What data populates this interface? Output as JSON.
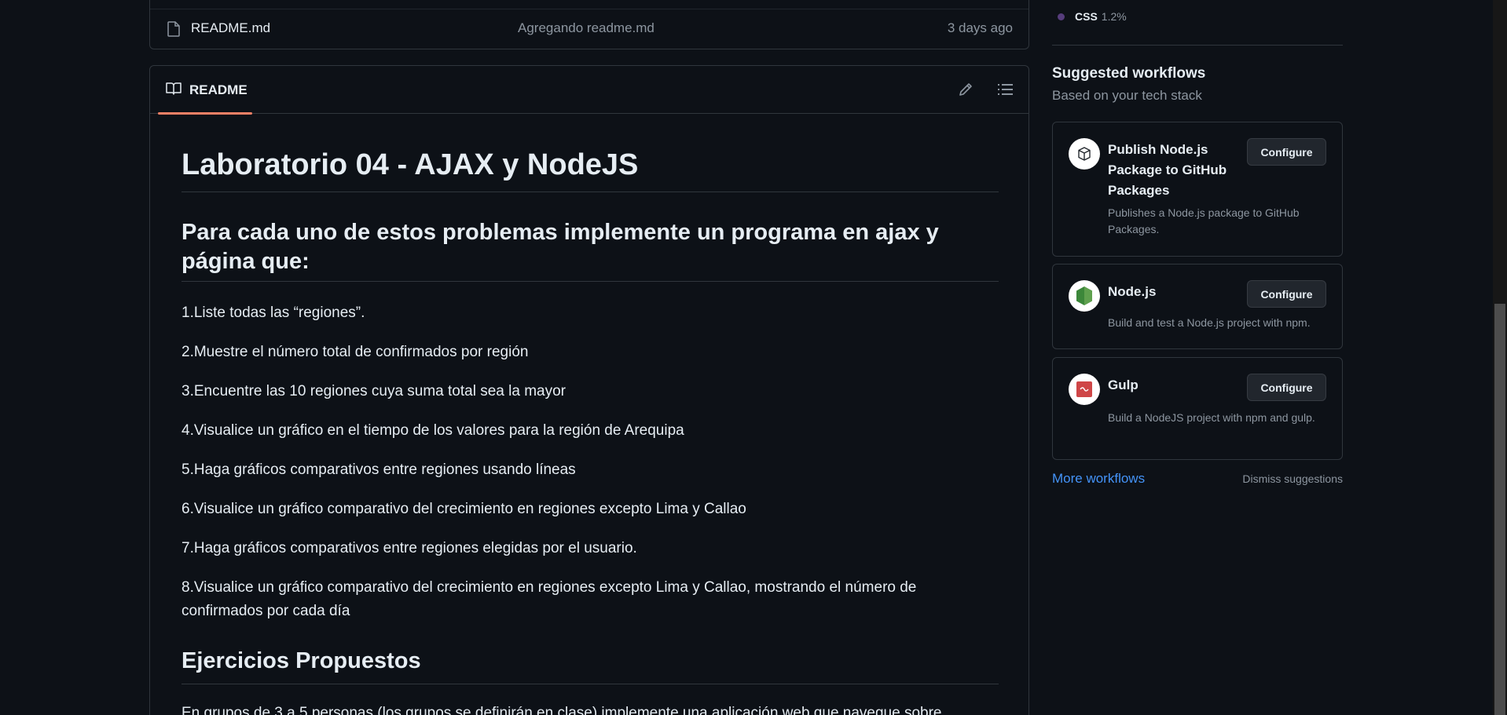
{
  "file_row": {
    "name": "README.md",
    "commit_message": "Agregando readme.md",
    "date": "3 days ago"
  },
  "readme": {
    "tab_label": "README",
    "title": "Laboratorio 04 - AJAX y NodeJS",
    "heading": "Para cada uno de estos problemas implemente un programa en ajax y página que:",
    "items": [
      "1.Liste todas las “regiones”.",
      "2.Muestre el número total de confirmados por región",
      "3.Encuentre las 10 regiones cuya suma total sea la mayor",
      "4.Visualice un gráfico en el tiempo de los valores para la región de Arequipa",
      "5.Haga gráficos comparativos entre regiones usando líneas",
      "6.Visualice un gráfico comparativo del crecimiento en regiones excepto Lima y Callao",
      "7.Haga gráficos comparativos entre regiones elegidas por el usuario.",
      "8.Visualice un gráfico comparativo del crecimiento en regiones excepto Lima y Callao, mostrando el número de confirmados por cada día"
    ],
    "heading2": "Ejercicios Propuestos",
    "paragraph_partial": "En grupos de 3 a 5 personas (los grupos se definirán en clase) implemente una aplicación web que navegue sobre"
  },
  "sidebar": {
    "language": {
      "name": "CSS",
      "percent": "1.2%",
      "color": "#563d7c"
    },
    "suggested_title": "Suggested workflows",
    "suggested_subtitle": "Based on your tech stack",
    "workflows": [
      {
        "name": "Publish Node.js Package to GitHub Packages",
        "description": "Publishes a Node.js package to GitHub Packages.",
        "button": "Configure",
        "icon": "package-icon"
      },
      {
        "name": "Node.js",
        "description": "Build and test a Node.js project with npm.",
        "button": "Configure",
        "icon": "nodejs-icon"
      },
      {
        "name": "Gulp",
        "description": "Build a NodeJS project with npm and gulp.",
        "button": "Configure",
        "icon": "gulp-icon"
      }
    ],
    "more_workflows": "More workflows",
    "dismiss": "Dismiss suggestions"
  },
  "colors": {
    "background": "#0d1117",
    "border": "#30363d",
    "link": "#4493f8",
    "tab_underline": "#f78166"
  }
}
